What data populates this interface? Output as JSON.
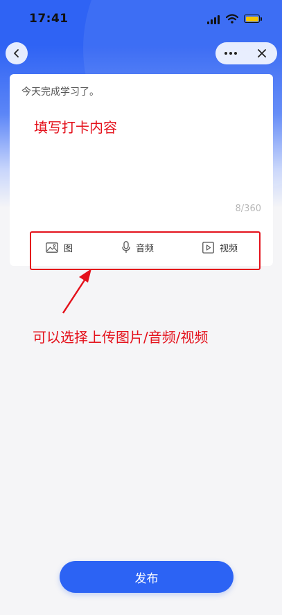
{
  "status_bar": {
    "time": "17:41"
  },
  "colors": {
    "primary": "#2c63f4",
    "annotation": "#e4111b",
    "background": "#f5f5f7"
  },
  "icons": {
    "back": "chevron-left-icon",
    "more": "more-dots-icon",
    "close": "close-icon",
    "image": "image-icon",
    "audio": "microphone-icon",
    "video": "video-play-icon"
  },
  "editor": {
    "content": "今天完成学习了。",
    "counter": "8/360"
  },
  "media": {
    "image_label": "图",
    "audio_label": "音频",
    "video_label": "视频"
  },
  "annotations": {
    "fill_content": "填写打卡内容",
    "upload_hint": "可以选择上传图片/音频/视频"
  },
  "footer": {
    "publish_label": "发布"
  }
}
